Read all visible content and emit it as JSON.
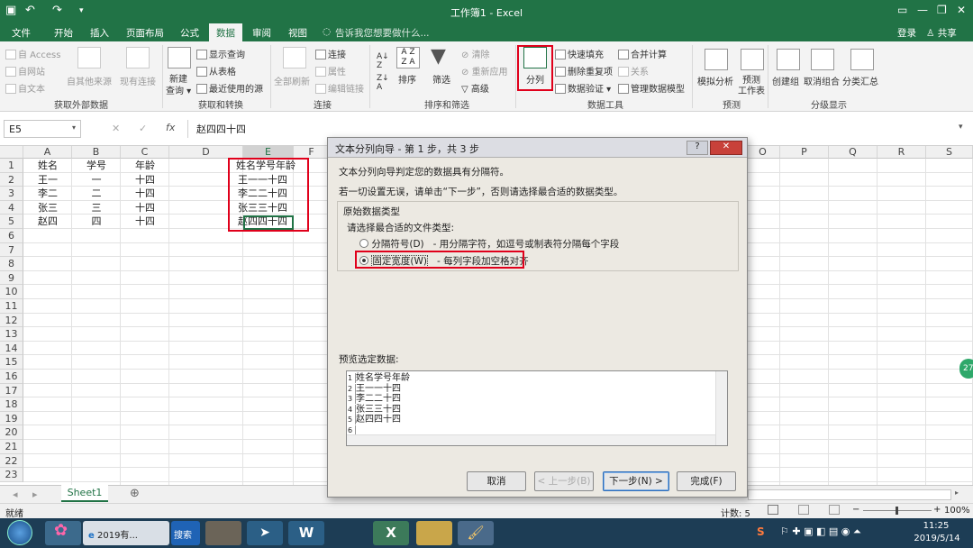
{
  "titlebar": {
    "doc_title": "工作簿1 - Excel",
    "undo": "↶",
    "redo": "↷",
    "min": "—",
    "restore": "❐",
    "close": "✕"
  },
  "menu": {
    "tabs": [
      "文件",
      "开始",
      "插入",
      "页面布局",
      "公式",
      "数据",
      "审阅",
      "视图"
    ],
    "active": "数据",
    "tell_me": "告诉我您想要做什么...",
    "login": "登录",
    "share": "共享"
  },
  "ribbon": {
    "get_external": {
      "access": "自 Access",
      "web": "自网站",
      "text": "自文本",
      "other": "自其他来源",
      "existing": "现有连接",
      "label": "获取外部数据"
    },
    "get_transform": {
      "new_query": "新建",
      "new_query2": "查询 ▾",
      "show_query": "显示查询",
      "from_table": "从表格",
      "recent": "最近使用的源",
      "label": "获取和转换"
    },
    "connections": {
      "refresh_all": "全部刷新",
      "connections": "连接",
      "properties": "属性",
      "edit_links": "编辑链接",
      "label": "连接"
    },
    "sort_filter": {
      "sort": "排序",
      "filter": "筛选",
      "clear": "清除",
      "reapply": "重新应用",
      "advanced": "高级",
      "label": "排序和筛选"
    },
    "data_tools": {
      "text_to_columns": "分列",
      "flash_fill": "快速填充",
      "remove_dup": "删除重复项",
      "validation": "数据验证 ▾",
      "consolidate": "合并计算",
      "relationships": "关系",
      "manage_model": "管理数据模型",
      "label": "数据工具"
    },
    "forecast": {
      "what_if": "模拟分析",
      "forecast": "预测",
      "forecast2": "工作表",
      "label": "预测"
    },
    "outline": {
      "group": "创建组",
      "ungroup": "取消组合",
      "subtotal": "分类汇总",
      "label": "分级显示"
    }
  },
  "formula_bar": {
    "name_box": "E5",
    "cancel": "✕",
    "enter": "✓",
    "fx": "fx",
    "value": "赵四四十四"
  },
  "grid": {
    "columns": [
      "A",
      "B",
      "C",
      "D",
      "E",
      "F",
      "O",
      "P",
      "Q",
      "R",
      "S"
    ],
    "rows": [
      "1",
      "2",
      "3",
      "4",
      "5",
      "6",
      "7",
      "8",
      "9",
      "10",
      "11",
      "12",
      "13",
      "14",
      "15",
      "16",
      "17",
      "18",
      "19",
      "20",
      "21",
      "22",
      "23"
    ],
    "data": [
      [
        "姓名",
        "学号",
        "年龄",
        "",
        "姓名学号年龄"
      ],
      [
        "王一",
        "一",
        "十四",
        "",
        "王一一十四"
      ],
      [
        "李二",
        "二",
        "十四",
        "",
        "李二二十四"
      ],
      [
        "张三",
        "三",
        "十四",
        "",
        "张三三十四"
      ],
      [
        "赵四",
        "四",
        "十四",
        "",
        "赵四四十四"
      ]
    ]
  },
  "sheets": {
    "active": "Sheet1",
    "add": "⊕"
  },
  "status": {
    "ready": "就绪",
    "count": "计数: 5",
    "zoom": "100%"
  },
  "dialog": {
    "title": "文本分列向导 - 第 1 步，共 3 步",
    "help": "?",
    "close": "✕",
    "line1": "文本分列向导判定您的数据具有分隔符。",
    "line2": "若一切设置无误，请单击“下一步”，否则请选择最合适的数据类型。",
    "section": "原始数据类型",
    "prompt": "请选择最合适的文件类型:",
    "opt1_label": "分隔符号(D)",
    "opt1_desc": "- 用分隔字符，如逗号或制表符分隔每个字段",
    "opt2_label": "固定宽度(W)",
    "opt2_desc": "- 每列字段加空格对齐",
    "preview_label": "预览选定数据:",
    "preview": [
      "姓名学号年龄",
      "王一一十四",
      "李二二十四",
      "张三三十四",
      "赵四四十四",
      ""
    ],
    "preview_nums": [
      "1",
      "2",
      "3",
      "4",
      "5",
      "6"
    ],
    "cancel": "取消",
    "back": "< 上一步(B)",
    "next": "下一步(N) >",
    "finish": "完成(F)"
  },
  "taskbar": {
    "task1": "2019有...",
    "search": "搜索",
    "time": "11:25",
    "date": "2019/5/14",
    "badge": "27"
  },
  "colors": {
    "excel_green": "#217346",
    "highlight_red": "#e0001b"
  }
}
